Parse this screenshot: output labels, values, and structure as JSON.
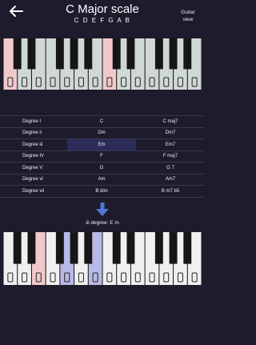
{
  "header": {
    "title": "C Major scale",
    "notes": "C D E F G A B",
    "guitar_view": "Guitar view"
  },
  "colors": {
    "background": "#1d1b2c",
    "white_key": "#f0f0f0",
    "scale_white_key": "#cfd8d5",
    "root_key": "#f1c9cc",
    "chord_key": "#b9b9e8",
    "black_key": "#161616",
    "selected_cell": "#2b2c58",
    "arrow": "#4e78d2"
  },
  "scale_piano": {
    "octaves": 2,
    "root_white_indices": [
      0,
      7
    ],
    "scale_white_indices": [
      0,
      1,
      2,
      3,
      4,
      5,
      6,
      7,
      8,
      9,
      10,
      11,
      12,
      13
    ]
  },
  "chord_table": {
    "selected_index": 2,
    "rows": [
      {
        "degree": "Degree I",
        "triad": "C",
        "seventh": "C maj7"
      },
      {
        "degree": "Degree ii",
        "triad": "Dm",
        "seventh": "Dm7"
      },
      {
        "degree": "Degree iii",
        "triad": "Em",
        "seventh": "Em7"
      },
      {
        "degree": "Degree IV",
        "triad": "F",
        "seventh": "F maj7"
      },
      {
        "degree": "Degree V",
        "triad": "G",
        "seventh": "G 7"
      },
      {
        "degree": "Degree vi",
        "triad": "Am",
        "seventh": "Am7"
      },
      {
        "degree": "Degree vii",
        "triad": "B dim",
        "seventh": "B m7 b5"
      }
    ]
  },
  "selected_chord": {
    "label": "iii degree: E m",
    "root_white_indices": [
      2
    ],
    "chord_white_indices": [
      4,
      6
    ]
  },
  "icons": {
    "back": "back-arrow-icon",
    "down": "down-arrow-icon"
  }
}
